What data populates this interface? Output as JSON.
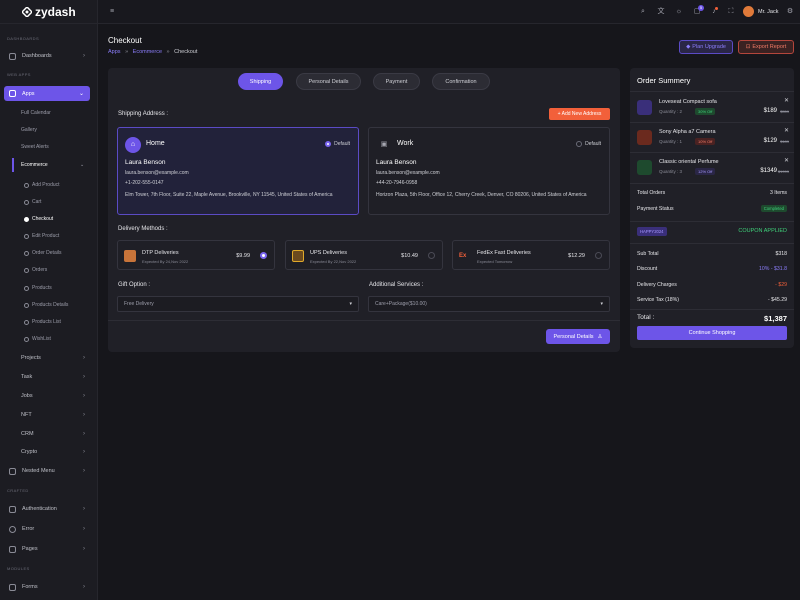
{
  "brand": {
    "name": "zydash"
  },
  "sidebar": {
    "sections": {
      "dashboards": "DASHBOARDS",
      "web_apps": "WEB APPS",
      "crafted": "CRAFTED",
      "modules": "MODULES"
    },
    "dashboards": "Dashboards",
    "apps": "Apps",
    "app_items": [
      "Full Calendar",
      "Gallery",
      "Sweet Alerts",
      "Ecommerce"
    ],
    "ecommerce_items": [
      "Add Product",
      "Cart",
      "Checkout",
      "Edit Product",
      "Order Details",
      "Orders",
      "Products",
      "Products Details",
      "Products List",
      "WishList"
    ],
    "more_items": [
      "Projects",
      "Task",
      "Jobs",
      "NFT",
      "CRM",
      "Crypto"
    ],
    "nested_menu": "Nested Menu",
    "crafted_items": [
      "Authentication",
      "Error",
      "Pages"
    ],
    "forms": "Forms"
  },
  "topbar": {
    "icons": [
      "menu-icon",
      "search-icon",
      "translate-icon",
      "theme-icon",
      "cart-icon",
      "bell-icon",
      "fullscreen-icon",
      "settings-icon"
    ],
    "cart_count": "5",
    "user_name": "Mr. Jack"
  },
  "header": {
    "title": "Checkout",
    "breadcrumb": [
      "Apps",
      "Ecommerce",
      "Checkout"
    ],
    "plan_upgrade": "Plan Upgrade",
    "export_report": "Export Report"
  },
  "steps": [
    "Shipping",
    "Personal Details",
    "Payment",
    "Confirmation"
  ],
  "shipping": {
    "label": "Shipping Address :",
    "add_new": "+ Add New Address",
    "addresses": [
      {
        "type": "Home",
        "default_label": "Default",
        "name": "Laura Benson",
        "email": "laura.benson@example.com",
        "phone": "+1-202-555-0147",
        "street": "Elm Tower, 7th Floor, Suite 22, Maple Avenue, Brookville, NY 11545, United States of America",
        "selected": true
      },
      {
        "type": "Work",
        "default_label": "Default",
        "name": "Laura Benson",
        "email": "laura.benson@example.com",
        "phone": "+44-20-7946-0958",
        "street": "Horizon Plaza, 5th Floor, Office 12, Cherry Creek, Denver, CO 80206, United States of America",
        "selected": false
      }
    ]
  },
  "delivery": {
    "label": "Delivery Methods :",
    "methods": [
      {
        "name": "DTP Deliveries",
        "sub": "Expected By 24,Nov 2022",
        "price": "$9.99",
        "selected": true
      },
      {
        "name": "UPS Deliveries",
        "sub": "Expected By 22,Nov 2022",
        "price": "$10.49",
        "selected": false
      },
      {
        "name": "FedEx Fast Deliveries",
        "sub": "Expected Tomorrow",
        "price": "$12.29",
        "selected": false
      }
    ]
  },
  "gift": {
    "label": "Gift Option :",
    "value": "Free Delivery"
  },
  "services": {
    "label": "Additional Services :",
    "value": "Care+Package($10.00)"
  },
  "next_button": "Personal Details",
  "summary": {
    "title": "Order Summery",
    "items": [
      {
        "name": "Loveseat Compact sofa",
        "qty": "Quantity : 2",
        "badge": "30% Off",
        "price": "$189",
        "old": "$559"
      },
      {
        "name": "Sony Alpha a7 Camera",
        "qty": "Quantity : 1",
        "badge": "10% Off",
        "price": "$129",
        "old": "$189"
      },
      {
        "name": "Classic oriental Perfume",
        "qty": "Quantity : 3",
        "badge": "12% Off",
        "price": "$1349",
        "old": "$1999"
      }
    ],
    "total_orders_label": "Total Orders",
    "total_orders_value": "3 Items",
    "payment_status_label": "Payment Status",
    "payment_status_value": "Completed",
    "coupon_code": "HAPPY2024",
    "coupon_status": "COUPON APPLIED",
    "subtotal_label": "Sub Total",
    "subtotal_value": "$318",
    "discount_label": "Discount",
    "discount_value": "10% - $31.8",
    "delivery_label": "Delivery Charges",
    "delivery_value": "- $29",
    "tax_label": "Service Tax (18%)",
    "tax_value": "- $45.29",
    "total_label": "Total :",
    "total_value": "$1,387",
    "continue_button": "Continue Shopping"
  }
}
